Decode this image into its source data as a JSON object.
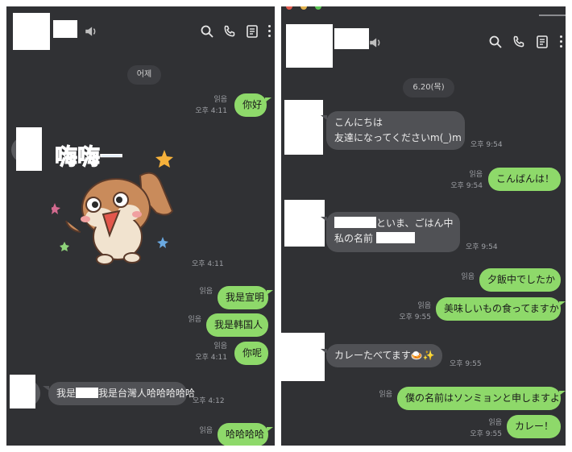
{
  "left": {
    "date_label": "어제",
    "header_icons": [
      "volume-icon",
      "search-icon",
      "phone-icon",
      "notes-icon",
      "more-icon"
    ],
    "messages": [
      {
        "dir": "out",
        "text": "你好",
        "read": "읽음",
        "time": "오후 4:11"
      },
      {
        "dir": "in",
        "type": "sticker",
        "sticker_text": "嗨嗨一",
        "time": "오후 4:11"
      },
      {
        "dir": "out",
        "text": "我是宣明",
        "read": "읽음",
        "time": ""
      },
      {
        "dir": "out",
        "text": "我是韩国人",
        "read": "읽음",
        "time": ""
      },
      {
        "dir": "out",
        "text": "你呢",
        "read": "읽음",
        "time": "오후 4:11"
      },
      {
        "dir": "in",
        "text_a": "我是",
        "text_b": "我是台灣人哈哈哈哈哈",
        "time": "오후 4:12"
      },
      {
        "dir": "out",
        "text": "哈哈哈哈",
        "read": "읽음",
        "time": ""
      }
    ]
  },
  "right": {
    "date_label": "6.20(목)",
    "header_icons": [
      "volume-icon",
      "search-icon",
      "phone-icon",
      "notes-icon",
      "more-icon"
    ],
    "messages": [
      {
        "dir": "in",
        "line1": "こんにちは",
        "line2": "友達になってくださいm(_)m",
        "time": "오후 9:54"
      },
      {
        "dir": "out",
        "text": "こんばんは！",
        "read": "읽음",
        "time": "오후 9:54"
      },
      {
        "dir": "in",
        "line1": "といま、ごはん中",
        "line2": "私の名前",
        "time": "오후 9:54"
      },
      {
        "dir": "out",
        "text": "夕飯中でしたか",
        "read": "읽음",
        "time": ""
      },
      {
        "dir": "out",
        "text": "美味しいもの食ってますか",
        "read": "읽음",
        "time": "오후 9:55"
      },
      {
        "dir": "in",
        "text": "カレーたべてます🍛✨",
        "time": "오후 9:55"
      },
      {
        "dir": "out",
        "text": "僕の名前はソンミョンと申しますよ",
        "read": "읽음",
        "time": ""
      },
      {
        "dir": "out",
        "text": "カレー！",
        "read": "읽음",
        "time": "오후 9:55"
      }
    ]
  },
  "colors": {
    "panel_bg": "#303134",
    "out_bubble": "#8ed96a",
    "in_bubble": "#505155",
    "meta_text": "#9ea0a5"
  }
}
